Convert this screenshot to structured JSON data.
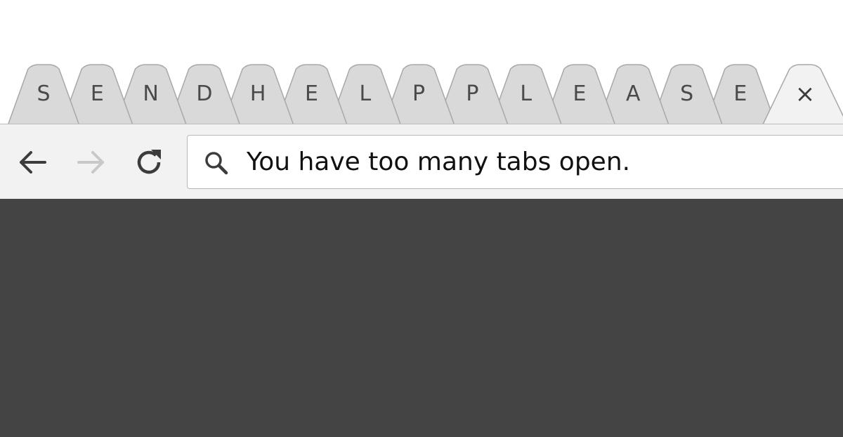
{
  "tabs": [
    {
      "label": "S"
    },
    {
      "label": "E"
    },
    {
      "label": "N"
    },
    {
      "label": "D"
    },
    {
      "label": "H"
    },
    {
      "label": "E"
    },
    {
      "label": "L"
    },
    {
      "label": "P"
    },
    {
      "label": "P"
    },
    {
      "label": "L"
    },
    {
      "label": "E"
    },
    {
      "label": "A"
    },
    {
      "label": "S"
    },
    {
      "label": "E"
    }
  ],
  "active_tab": {
    "close_symbol": "×"
  },
  "toolbar": {
    "back_icon": "arrow-left-icon",
    "forward_icon": "arrow-right-icon",
    "reload_icon": "reload-icon",
    "forward_enabled": false
  },
  "omnibox": {
    "icon": "search-icon",
    "text": "You have too many tabs open."
  },
  "colors": {
    "tab_fill": "#d9d9d9",
    "tab_border": "#a8a8a8",
    "active_tab_fill": "#f2f2f2",
    "toolbar": "#f2f2f2",
    "content": "#444444",
    "disabled_icon": "#c8c8c8"
  }
}
